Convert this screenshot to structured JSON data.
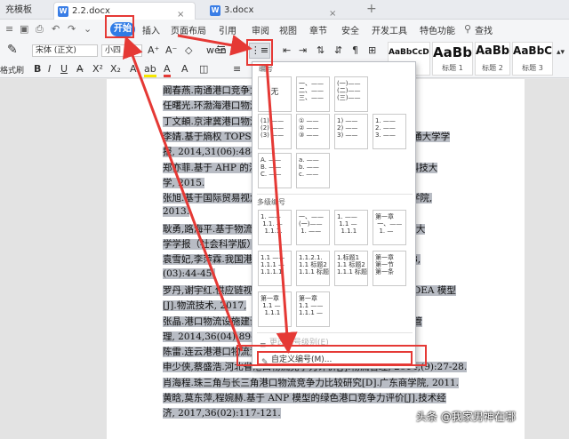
{
  "tabs": [
    {
      "label": "充模板",
      "active": false
    },
    {
      "label": "2.2.docx",
      "active": true
    },
    {
      "label": "3.docx",
      "active": false
    }
  ],
  "menu": {
    "start": "开始",
    "items": [
      "插入",
      "页面布局",
      "引用",
      "审阅",
      "视图",
      "章节",
      "安全",
      "开发工具",
      "特色功能"
    ],
    "search": "查找"
  },
  "toolbar": {
    "font_name": "宋体 (正文)",
    "font_size": "小四",
    "format_painter": "格式刷"
  },
  "styles": [
    {
      "sample": "AaBbCcDd",
      "name": "正文"
    },
    {
      "sample": "AaBb",
      "name": "标题 1"
    },
    {
      "sample": "AaBb(",
      "name": "标题 2"
    },
    {
      "sample": "AaBbC",
      "name": "标题 3"
    }
  ],
  "dropdown": {
    "header": "编号",
    "none_label": "无",
    "section_multi": "多级编号",
    "numbering_thumbs": [
      "一、——\n二、——\n三、——",
      "(一)——\n(二)——\n(三)——",
      "1. ——\n2. ——\n3. ——",
      "(1) ——\n(2) ——\n(3) ——",
      "① ——\n② ——\n③ ——",
      "1) ——\n2) ——\n3) ——",
      "A. ——\nB. ——\nC. ——",
      "a. ——\nb. ——\nc. ——"
    ],
    "multi_thumbs": [
      "1. ——\n 1.1. —\n  1.1.1.",
      "一、——\n(一)——\n 1. ——",
      "1. ——\n 1.1 —\n  1.1.1",
      "第一章\n 一、——\n  1. —",
      "1.1 ——\n1.1.1 —\n1.1.1.1",
      "1.1.2.1.\n1.1 标题2\n1.1.1 标题3",
      "1.标题1\n1.1 标题2\n1.1.1 标题3",
      "第一章\n第一节\n第一条",
      "第一章\n 1.1 —\n  1.1.1",
      "第一章\n1.1 ——\n1.1.1 —"
    ],
    "change_level": "更改编号级别(E)",
    "custom_label": "自定义编号(M)..."
  },
  "document_lines": [
    "阚春燕.南通港口竞争力评价研究[D].大连理工大学, 2009.",
    "任曙光.环渤海港口物流竞争力评价研究[D].2011.",
    "丁文頔.京津冀港口物流竞争力评价研究[D].2017.",
    "李婧.基于熵权 TOPSIS 法的港口竞争力评价研究[D].华东交通大学学",
    "报, 2014,31(06):48-52.",
    "郑亦菲.基于 AHP 的港口物流竞争力评价研究[D].成都:电子科技大",
    "学, 2015.",
    "张旭.基于国际贸易视角的港口竞争力研究[D].舟山:浙江海洋学院,",
    "2013.",
    "耿勇,路海平.基于物流视角的港口竞争力提升策略研究[J].贵州大",
    "学学报（社会科学版）, 2016.",
    "袁雪妃,李萍霖.我国港口竞争力评价研究[J].物流科技刊, 2018,",
    "(03):44-45.",
    "罗丹,谢宇红.供应链视角下基于 DEA 模型的港口效率三阶段 DEA 模型",
    "[J].物流技术, 2017,",
    "张晶.港口物流设施建设与港口竞争力关系研究[J].港口经济与管",
    "理, 2014,36(04):89-93.",
    "陈雷.连云港港口物流竞争力评价研究[J].现代商业, 2010.",
    "申少侠,蔡盛浩.河北省港口物流竞争力评价[J].物流管理, 2014,(9):27-28.",
    "肖海程.珠三角与长三角港口物流竞争力比较研究[D].广东商学院, 2011.",
    "黄晗,莫东萍,程婉赫.基于 ANP 模型的绿色港口竞争力评价[J].技术经",
    "济, 2017,36(02):117-121."
  ],
  "watermark": "头条 @我家男神在哪"
}
